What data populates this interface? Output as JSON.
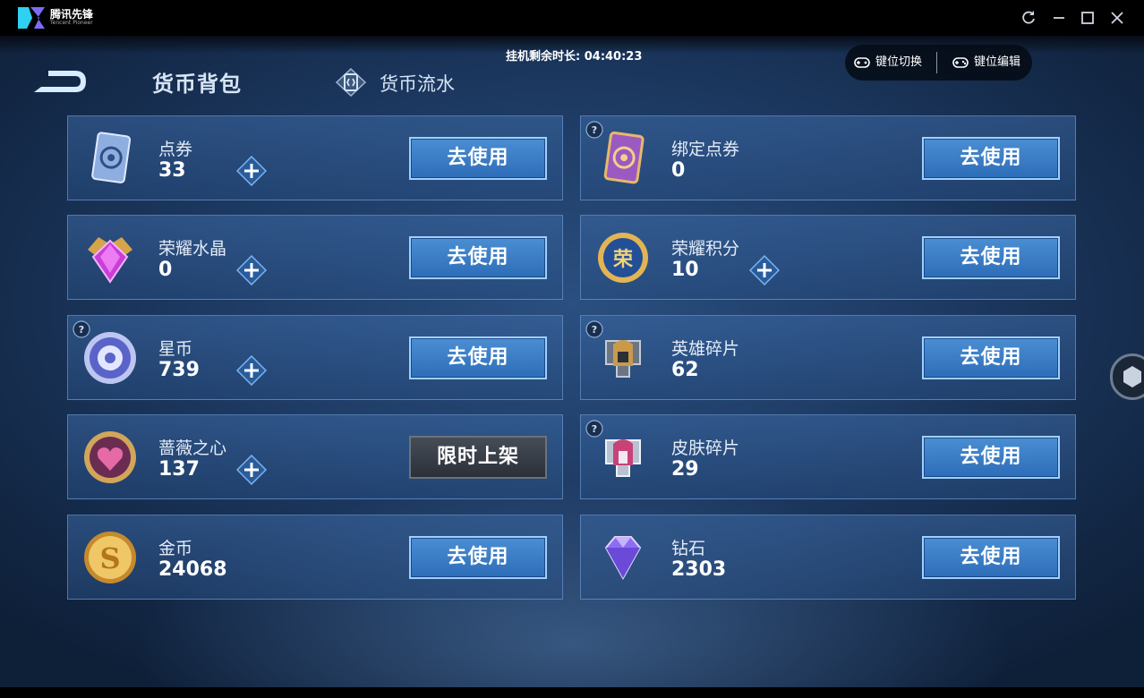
{
  "app": {
    "logo_line1": "腾讯先锋",
    "logo_line2": "Tencent Pioneer"
  },
  "window_controls": [
    "refresh-icon",
    "minimize-icon",
    "maximize-icon",
    "close-icon"
  ],
  "timer": "挂机剩余时长: 04:40:23",
  "keypanel": {
    "switch": "键位切换",
    "edit": "键位编辑"
  },
  "tabs": {
    "active": "货币背包",
    "other": "货币流水"
  },
  "cards": [
    {
      "icon": "voucher-icon",
      "name": "点券",
      "value": "33",
      "plus": true,
      "help": false,
      "button": "去使用"
    },
    {
      "icon": "bound-voucher-icon",
      "name": "绑定点券",
      "value": "0",
      "plus": false,
      "help": true,
      "button": "去使用"
    },
    {
      "icon": "glory-crystal-icon",
      "name": "荣耀水晶",
      "value": "0",
      "plus": true,
      "help": false,
      "button": "去使用"
    },
    {
      "icon": "glory-points-icon",
      "name": "荣耀积分",
      "value": "10",
      "plus": true,
      "help": false,
      "button": "去使用"
    },
    {
      "icon": "star-coin-icon",
      "name": "星币",
      "value": "739",
      "plus": true,
      "help": true,
      "button": "去使用"
    },
    {
      "icon": "hero-fragment-icon",
      "name": "英雄碎片",
      "value": "62",
      "plus": false,
      "help": true,
      "button": "去使用"
    },
    {
      "icon": "rose-heart-icon",
      "name": "蔷薇之心",
      "value": "137",
      "plus": true,
      "help": false,
      "button": "限时上架",
      "button_disabled": true
    },
    {
      "icon": "skin-fragment-icon",
      "name": "皮肤碎片",
      "value": "29",
      "plus": false,
      "help": true,
      "button": "去使用"
    },
    {
      "icon": "gold-coin-icon",
      "name": "金币",
      "value": "24068",
      "plus": false,
      "help": false,
      "button": "去使用"
    },
    {
      "icon": "diamond-icon",
      "name": "钻石",
      "value": "2303",
      "plus": false,
      "help": false,
      "button": "去使用"
    }
  ]
}
